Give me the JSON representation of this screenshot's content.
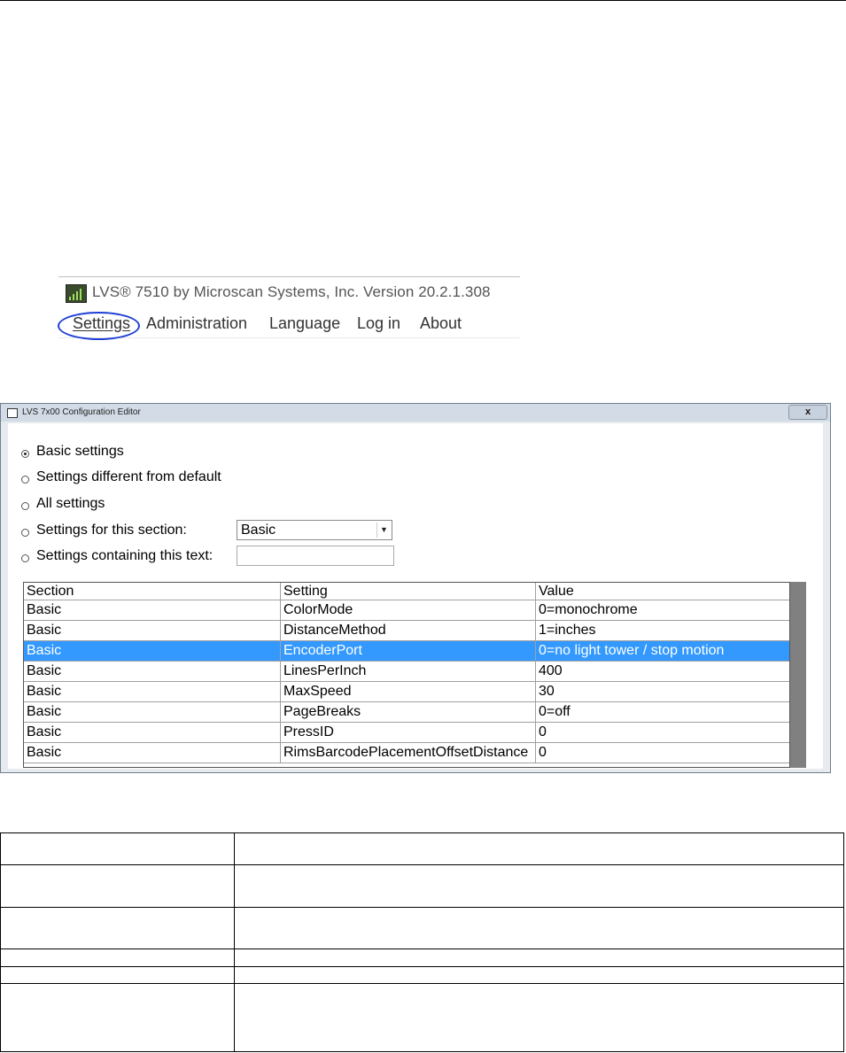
{
  "app_snippet": {
    "title": "LVS® 7510 by Microscan Systems, Inc.   Version 20.2.1.308",
    "menu": [
      {
        "label": "Settings",
        "highlighted": true
      },
      {
        "label": "Administration"
      },
      {
        "label": "Language"
      },
      {
        "label": "Log in"
      },
      {
        "label": "About"
      }
    ],
    "icon": "lvs-app-icon",
    "highlight_color": "#1e3fd6"
  },
  "config_editor": {
    "title": "LVS 7x00 Configuration Editor",
    "close_label": "x",
    "filters": [
      {
        "label": "Basic settings",
        "checked": true
      },
      {
        "label": "Settings different from default",
        "checked": false
      },
      {
        "label": "All settings",
        "checked": false
      },
      {
        "label": "Settings for this section:",
        "checked": false
      },
      {
        "label": "Settings containing this text:",
        "checked": false
      }
    ],
    "section_select_value": "Basic",
    "search_text_value": "",
    "grid": {
      "columns": [
        "Section",
        "Setting",
        "Value"
      ],
      "rows": [
        [
          "Basic",
          "ColorMode",
          "0=monochrome"
        ],
        [
          "Basic",
          "DistanceMethod",
          "1=inches"
        ],
        [
          "Basic",
          "EncoderPort",
          "0=no light tower / stop motion"
        ],
        [
          "Basic",
          "LinesPerInch",
          "400"
        ],
        [
          "Basic",
          "MaxSpeed",
          "30"
        ],
        [
          "Basic",
          "PageBreaks",
          "0=off"
        ],
        [
          "Basic",
          "PressID",
          "0"
        ],
        [
          "Basic",
          "RimsBarcodePlacementOffsetDistance",
          "0"
        ]
      ],
      "selected_row": 2,
      "selection_color": "#3399ff"
    }
  }
}
